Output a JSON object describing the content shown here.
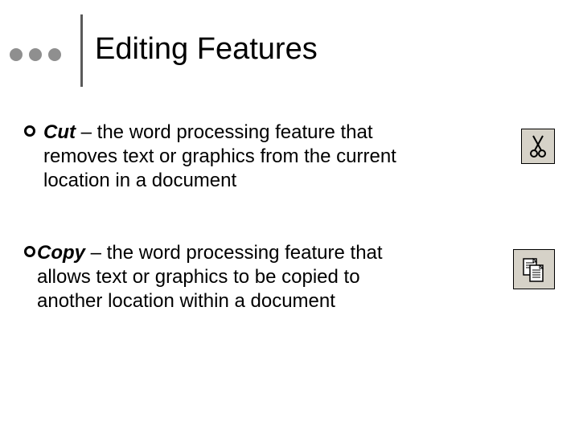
{
  "title": "Editing Features",
  "bullets": [
    {
      "term": "Cut",
      "definition": " – the word processing feature that removes text or graphics from the current location in a document",
      "icon": "scissors"
    },
    {
      "term": "Copy",
      "definition": " – the word processing feature that allows text or graphics to be copied to another location within a document",
      "icon": "copy"
    }
  ]
}
